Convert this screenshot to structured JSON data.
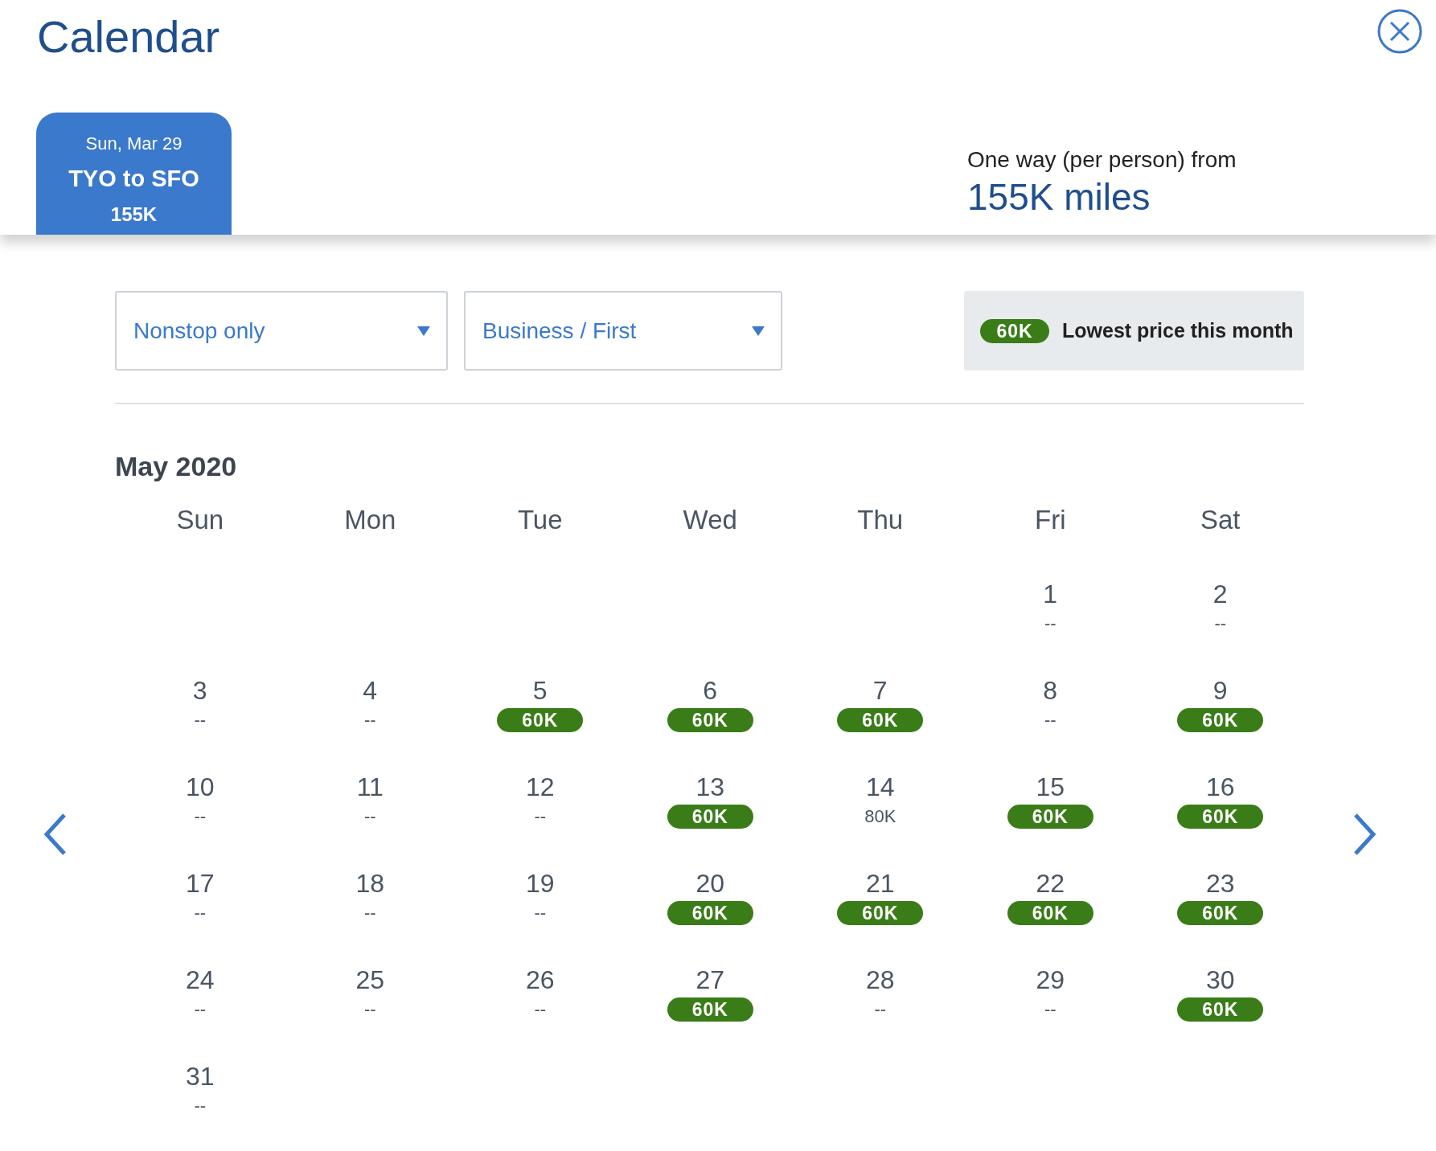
{
  "title": "Calendar",
  "trip_tabs": [
    {
      "date": "Sun, Mar 29",
      "route": "TYO to SFO",
      "price": "155K",
      "selected": true
    }
  ],
  "summary": {
    "label": "One way (per person) from",
    "price": "155K miles"
  },
  "filters": [
    {
      "value": "Nonstop only"
    },
    {
      "value": "Business / First"
    }
  ],
  "legend": {
    "badge": "60K",
    "label": "Lowest price this month"
  },
  "month": "May 2020",
  "weekdays": [
    "Sun",
    "Mon",
    "Tue",
    "Wed",
    "Thu",
    "Fri",
    "Sat"
  ],
  "weeks": [
    [
      {
        "kind": "empty"
      },
      {
        "kind": "empty"
      },
      {
        "kind": "empty"
      },
      {
        "kind": "empty"
      },
      {
        "kind": "empty"
      },
      {
        "kind": "day",
        "day": "1",
        "price": "--",
        "lowest": false
      },
      {
        "kind": "day",
        "day": "2",
        "price": "--",
        "lowest": false
      }
    ],
    [
      {
        "kind": "day",
        "day": "3",
        "price": "--",
        "lowest": false
      },
      {
        "kind": "day",
        "day": "4",
        "price": "--",
        "lowest": false
      },
      {
        "kind": "day",
        "day": "5",
        "price": "60K",
        "lowest": true
      },
      {
        "kind": "day",
        "day": "6",
        "price": "60K",
        "lowest": true
      },
      {
        "kind": "day",
        "day": "7",
        "price": "60K",
        "lowest": true
      },
      {
        "kind": "day",
        "day": "8",
        "price": "--",
        "lowest": false
      },
      {
        "kind": "day",
        "day": "9",
        "price": "60K",
        "lowest": true
      }
    ],
    [
      {
        "kind": "day",
        "day": "10",
        "price": "--",
        "lowest": false
      },
      {
        "kind": "day",
        "day": "11",
        "price": "--",
        "lowest": false
      },
      {
        "kind": "day",
        "day": "12",
        "price": "--",
        "lowest": false
      },
      {
        "kind": "day",
        "day": "13",
        "price": "60K",
        "lowest": true
      },
      {
        "kind": "day",
        "day": "14",
        "price": "80K",
        "lowest": false
      },
      {
        "kind": "day",
        "day": "15",
        "price": "60K",
        "lowest": true
      },
      {
        "kind": "day",
        "day": "16",
        "price": "60K",
        "lowest": true
      }
    ],
    [
      {
        "kind": "day",
        "day": "17",
        "price": "--",
        "lowest": false
      },
      {
        "kind": "day",
        "day": "18",
        "price": "--",
        "lowest": false
      },
      {
        "kind": "day",
        "day": "19",
        "price": "--",
        "lowest": false
      },
      {
        "kind": "day",
        "day": "20",
        "price": "60K",
        "lowest": true
      },
      {
        "kind": "day",
        "day": "21",
        "price": "60K",
        "lowest": true
      },
      {
        "kind": "day",
        "day": "22",
        "price": "60K",
        "lowest": true
      },
      {
        "kind": "day",
        "day": "23",
        "price": "60K",
        "lowest": true
      }
    ],
    [
      {
        "kind": "day",
        "day": "24",
        "price": "--",
        "lowest": false
      },
      {
        "kind": "day",
        "day": "25",
        "price": "--",
        "lowest": false
      },
      {
        "kind": "day",
        "day": "26",
        "price": "--",
        "lowest": false
      },
      {
        "kind": "day",
        "day": "27",
        "price": "60K",
        "lowest": true
      },
      {
        "kind": "day",
        "day": "28",
        "price": "--",
        "lowest": false
      },
      {
        "kind": "day",
        "day": "29",
        "price": "--",
        "lowest": false
      },
      {
        "kind": "day",
        "day": "30",
        "price": "60K",
        "lowest": true
      }
    ],
    [
      {
        "kind": "day",
        "day": "31",
        "price": "--",
        "lowest": false
      }
    ]
  ]
}
